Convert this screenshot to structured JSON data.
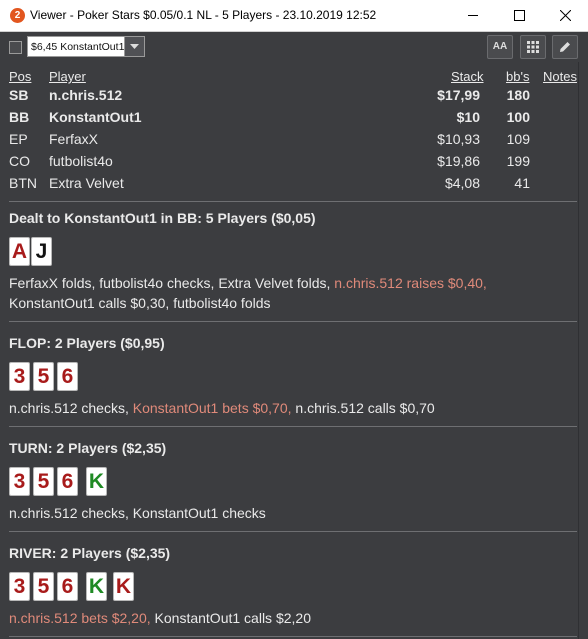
{
  "window": {
    "icon_glyph": "2",
    "title": "Viewer - Poker Stars $0.05/0.1 NL - 5 Players - 23.10.2019 12:52"
  },
  "toolbar": {
    "select_value": "$6,45 KonstantOut1",
    "font_button_label": "AA"
  },
  "players_table": {
    "headers": {
      "pos": "Pos",
      "player": "Player",
      "stack": "Stack",
      "bbs": "bb's",
      "notes": "Notes"
    },
    "rows": [
      {
        "pos": "SB",
        "name": "n.chris.512",
        "stack": "$17,99",
        "bbs": "180",
        "bold": true
      },
      {
        "pos": "BB",
        "name": "KonstantOut1",
        "stack": "$10",
        "bbs": "100",
        "bold": true
      },
      {
        "pos": "EP",
        "name": "FerfaxX",
        "stack": "$10,93",
        "bbs": "109",
        "bold": false
      },
      {
        "pos": "CO",
        "name": "futbolist4o",
        "stack": "$19,86",
        "bbs": "199",
        "bold": false
      },
      {
        "pos": "BTN",
        "name": "Extra Velvet",
        "stack": "$4,08",
        "bbs": "41",
        "bold": false
      }
    ]
  },
  "preflop": {
    "header": "Dealt to KonstantOut1 in BB: 5 Players ($0,05)",
    "cards": [
      {
        "rank": "A",
        "color": "red"
      },
      {
        "rank": "J",
        "color": "black"
      }
    ],
    "line1": [
      {
        "text": "FerfaxX folds, futbolist4o checks, Extra Velvet folds, ",
        "hl": false
      },
      {
        "text": "n.chris.512 raises $0,40,",
        "hl": true
      }
    ],
    "line2": [
      {
        "text": "KonstantOut1 calls $0,30, futbolist4o folds",
        "hl": false
      }
    ]
  },
  "flop": {
    "header": "FLOP: 2 Players ($0,95)",
    "cards": [
      {
        "rank": "3",
        "color": "red"
      },
      {
        "rank": "5",
        "color": "red"
      },
      {
        "rank": "6",
        "color": "red"
      }
    ],
    "line1": [
      {
        "text": "n.chris.512 checks, ",
        "hl": false
      },
      {
        "text": "KonstantOut1 bets $0,70,",
        "hl": true
      },
      {
        "text": " n.chris.512 calls $0,70",
        "hl": false
      }
    ]
  },
  "turn": {
    "header": "TURN: 2 Players ($2,35)",
    "cards": [
      {
        "rank": "3",
        "color": "red"
      },
      {
        "rank": "5",
        "color": "red"
      },
      {
        "rank": "6",
        "color": "red"
      },
      {
        "rank": "K",
        "color": "green"
      }
    ],
    "line1": [
      {
        "text": "n.chris.512 checks, KonstantOut1 checks",
        "hl": false
      }
    ]
  },
  "river": {
    "header": "RIVER: 2 Players ($2,35)",
    "cards": [
      {
        "rank": "3",
        "color": "red"
      },
      {
        "rank": "5",
        "color": "red"
      },
      {
        "rank": "6",
        "color": "red"
      },
      {
        "rank": "K",
        "color": "green"
      },
      {
        "rank": "K",
        "color": "red"
      }
    ],
    "line1": [
      {
        "text": "n.chris.512 bets $2,20,",
        "hl": true
      },
      {
        "text": " KonstantOut1 calls $2,20",
        "hl": false
      }
    ]
  },
  "colors": {
    "background": "#3c3d40",
    "highlight_action": "#e08a7a",
    "card_red": "#a81b1b",
    "card_green": "#1f8a24",
    "card_black": "#111111"
  },
  "icons": [
    "app-icon",
    "minimize-icon",
    "maximize-icon",
    "close-icon",
    "chevron-down-icon",
    "font-size-icon",
    "grid-icon",
    "edit-pencil-icon"
  ]
}
